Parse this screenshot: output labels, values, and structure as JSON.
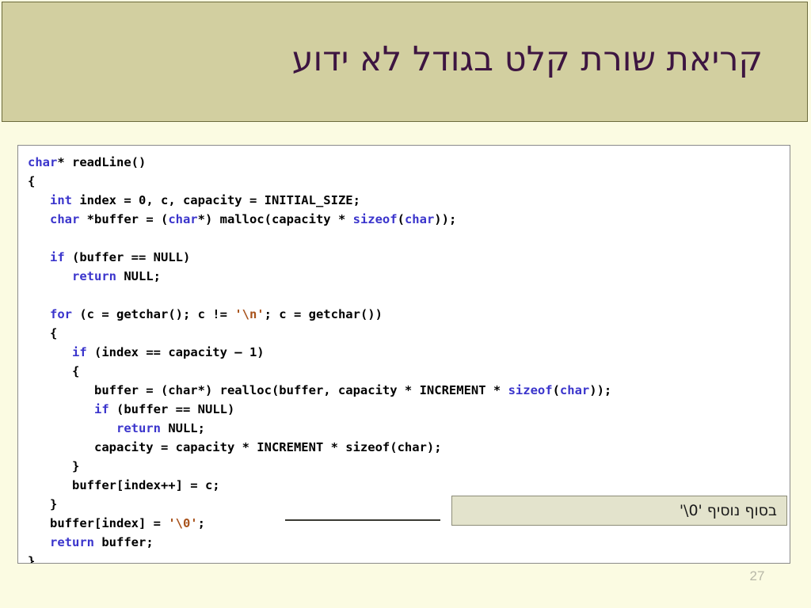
{
  "slide": {
    "title": "קריאת שורת קלט בגודל לא ידוע",
    "page_number": "27",
    "colors": {
      "title_band_bg": "#D2CFA0",
      "title_band_border": "#6C6B3C",
      "title_text": "#3D1541",
      "slide_bg": "#FBFBE2",
      "code_bg": "#FFFFFF",
      "code_border": "#8A8A8A",
      "keyword_blue": "#3A34CC",
      "string_brown": "#A8521B",
      "callout_bg": "#E3E3CC",
      "callout_border": "#8C8C78",
      "connector_line": "#3A3A32",
      "page_number_color": "#B8B8A8"
    }
  },
  "code": {
    "language": "c",
    "lines": [
      [
        {
          "t": "char",
          "c": "kw"
        },
        {
          "t": "* readLine()",
          "c": ""
        }
      ],
      [
        {
          "t": "{",
          "c": ""
        }
      ],
      [
        {
          "t": "   ",
          "c": ""
        },
        {
          "t": "int",
          "c": "kw"
        },
        {
          "t": " index = 0, c, capacity = INITIAL_SIZE;",
          "c": ""
        }
      ],
      [
        {
          "t": "   ",
          "c": ""
        },
        {
          "t": "char",
          "c": "kw"
        },
        {
          "t": " *buffer = (",
          "c": ""
        },
        {
          "t": "char",
          "c": "kw"
        },
        {
          "t": "*) malloc(capacity * ",
          "c": ""
        },
        {
          "t": "sizeof",
          "c": "kw"
        },
        {
          "t": "(",
          "c": ""
        },
        {
          "t": "char",
          "c": "kw"
        },
        {
          "t": "));",
          "c": ""
        }
      ],
      [
        {
          "t": "",
          "c": ""
        }
      ],
      [
        {
          "t": "   ",
          "c": ""
        },
        {
          "t": "if",
          "c": "kw"
        },
        {
          "t": " (buffer == NULL)",
          "c": ""
        }
      ],
      [
        {
          "t": "      ",
          "c": ""
        },
        {
          "t": "return",
          "c": "kw"
        },
        {
          "t": " NULL;",
          "c": ""
        }
      ],
      [
        {
          "t": "",
          "c": ""
        }
      ],
      [
        {
          "t": "   ",
          "c": ""
        },
        {
          "t": "for",
          "c": "kw"
        },
        {
          "t": " (c = getchar(); c != ",
          "c": ""
        },
        {
          "t": "'\\n'",
          "c": "str"
        },
        {
          "t": "; c = getchar())",
          "c": ""
        }
      ],
      [
        {
          "t": "   {",
          "c": ""
        }
      ],
      [
        {
          "t": "      ",
          "c": ""
        },
        {
          "t": "if",
          "c": "kw"
        },
        {
          "t": " (index == capacity – 1)",
          "c": ""
        }
      ],
      [
        {
          "t": "      {",
          "c": ""
        }
      ],
      [
        {
          "t": "         buffer = (char*) realloc(buffer, capacity * INCREMENT * ",
          "c": ""
        },
        {
          "t": "sizeof",
          "c": "kw"
        },
        {
          "t": "(",
          "c": ""
        },
        {
          "t": "char",
          "c": "kw"
        },
        {
          "t": "));",
          "c": ""
        }
      ],
      [
        {
          "t": "         ",
          "c": ""
        },
        {
          "t": "if",
          "c": "kw"
        },
        {
          "t": " (buffer == NULL)",
          "c": ""
        }
      ],
      [
        {
          "t": "            ",
          "c": ""
        },
        {
          "t": "return",
          "c": "kw"
        },
        {
          "t": " NULL;",
          "c": ""
        }
      ],
      [
        {
          "t": "         capacity = capacity * INCREMENT * sizeof(char);",
          "c": ""
        }
      ],
      [
        {
          "t": "      }",
          "c": ""
        }
      ],
      [
        {
          "t": "      buffer[index++] = c;",
          "c": ""
        }
      ],
      [
        {
          "t": "   }",
          "c": ""
        }
      ],
      [
        {
          "t": "   buffer[index] = ",
          "c": ""
        },
        {
          "t": "'\\0'",
          "c": "str"
        },
        {
          "t": ";",
          "c": ""
        }
      ],
      [
        {
          "t": "   ",
          "c": ""
        },
        {
          "t": "return",
          "c": "kw"
        },
        {
          "t": " buffer;",
          "c": ""
        }
      ],
      [
        {
          "t": "}",
          "c": ""
        }
      ]
    ]
  },
  "callout": {
    "text": "בסוף נוסיף '0\\'"
  }
}
